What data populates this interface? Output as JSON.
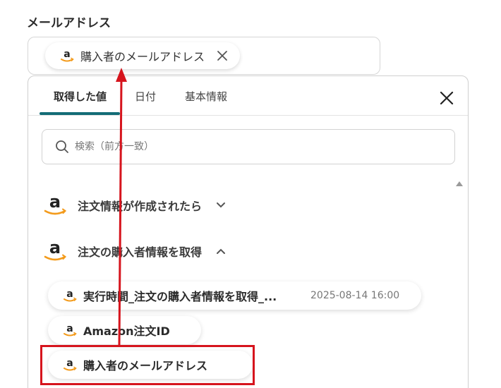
{
  "field": {
    "label": "メールアドレス",
    "chip_text": "購入者のメールアドレス"
  },
  "tabs": [
    {
      "label": "取得した値",
      "active": true
    },
    {
      "label": "日付",
      "active": false
    },
    {
      "label": "基本情報",
      "active": false
    }
  ],
  "search": {
    "placeholder": "検索（前方一致）"
  },
  "sections": [
    {
      "title": "注文情報が作成されたら",
      "expanded": false
    },
    {
      "title": "注文の購入者情報を取得",
      "expanded": true
    }
  ],
  "items": [
    {
      "label": "実行時間_注文の購入者情報を取得_...",
      "value": "2025-08-14 16:00"
    },
    {
      "label": "Amazon注文ID",
      "value": ""
    },
    {
      "label": "購入者のメールアドレス",
      "value": ""
    }
  ],
  "colors": {
    "accent": "#136c76",
    "annotation_red": "#d6141d",
    "amazon_orange": "#f39b1c"
  },
  "icons": [
    "amazon-logo-icon",
    "close-icon",
    "search-icon",
    "chevron-down-icon",
    "chevron-up-icon"
  ]
}
